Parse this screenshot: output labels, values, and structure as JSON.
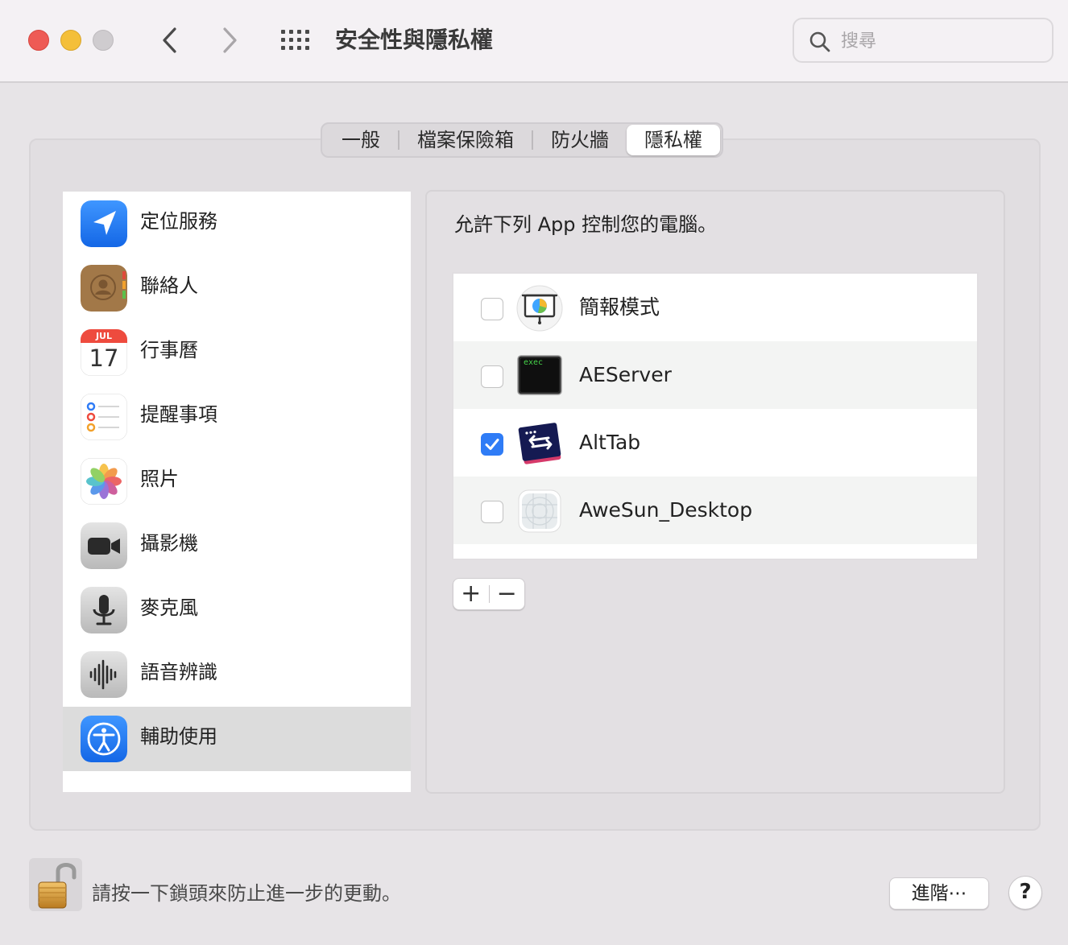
{
  "window": {
    "title": "安全性與隱私權",
    "search_placeholder": "搜尋"
  },
  "tabs": [
    {
      "label": "一般",
      "active": false
    },
    {
      "label": "檔案保險箱",
      "active": false
    },
    {
      "label": "防火牆",
      "active": false
    },
    {
      "label": "隱私權",
      "active": true
    }
  ],
  "sidebar": {
    "items": [
      {
        "label": "定位服務",
        "icon": "location-icon"
      },
      {
        "label": "聯絡人",
        "icon": "contacts-icon"
      },
      {
        "label": "行事曆",
        "icon": "calendar-icon",
        "month": "JUL",
        "day": "17"
      },
      {
        "label": "提醒事項",
        "icon": "reminders-icon"
      },
      {
        "label": "照片",
        "icon": "photos-icon"
      },
      {
        "label": "攝影機",
        "icon": "camera-icon"
      },
      {
        "label": "麥克風",
        "icon": "microphone-icon"
      },
      {
        "label": "語音辨識",
        "icon": "speech-recognition-icon"
      },
      {
        "label": "輔助使用",
        "icon": "accessibility-icon",
        "selected": true
      }
    ]
  },
  "pane": {
    "description": "允許下列 App 控制您的電腦。",
    "apps": [
      {
        "name": "簡報模式",
        "checked": false,
        "icon": "presentation-icon"
      },
      {
        "name": "AEServer",
        "checked": false,
        "icon": "exec-terminal-icon",
        "icon_text": "exec"
      },
      {
        "name": "AltTab",
        "checked": true,
        "icon": "alttab-icon"
      },
      {
        "name": "AweSun_Desktop",
        "checked": false,
        "icon": "awesun-icon"
      }
    ],
    "add_label": "+",
    "remove_label": "−"
  },
  "footer": {
    "lock_text": "請按一下鎖頭來防止進一步的更動。",
    "advanced_label": "進階⋯",
    "help_label": "?"
  },
  "colors": {
    "accent": "#2f7cf6",
    "close": "#ee5b55",
    "minimize": "#f4bf39"
  }
}
